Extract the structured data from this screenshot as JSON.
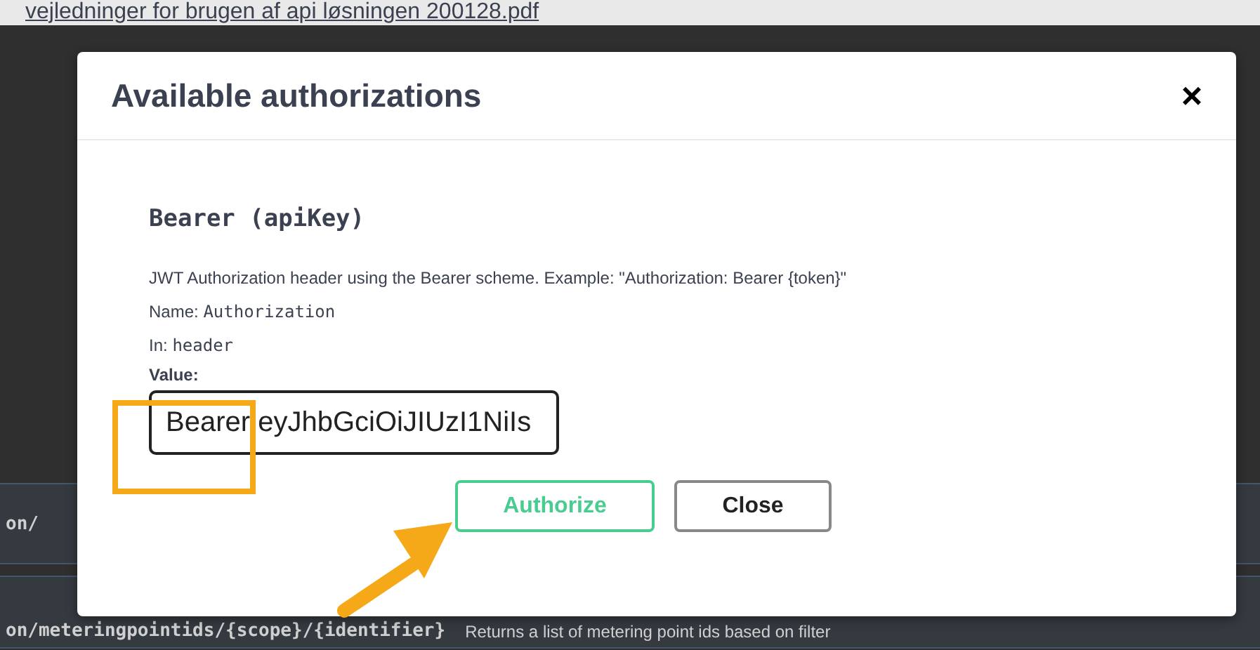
{
  "page": {
    "link": "vejledninger for brugen af api løsningen 200128.pdf",
    "endpoints": [
      {
        "path": "on/"
      },
      {
        "path": "on/meteringpointids/{scope}/{identifier}",
        "description": "Returns a list of metering point ids based on filter"
      }
    ]
  },
  "dialog": {
    "title": "Available authorizations",
    "close": "×",
    "scheme": {
      "name": "Bearer (apiKey)",
      "description": "JWT Authorization header using the Bearer scheme. Example: \"Authorization: Bearer {token}\"",
      "name_label": "Name:",
      "name_value": "Authorization",
      "in_label": "In:",
      "in_value": "header",
      "value_label": "Value:",
      "value": "Bearer eyJhbGciOiJIUzI1NiIs"
    },
    "buttons": [
      {
        "label": "Authorize",
        "kind": "primary"
      },
      {
        "label": "Close",
        "kind": "secondary"
      }
    ]
  }
}
